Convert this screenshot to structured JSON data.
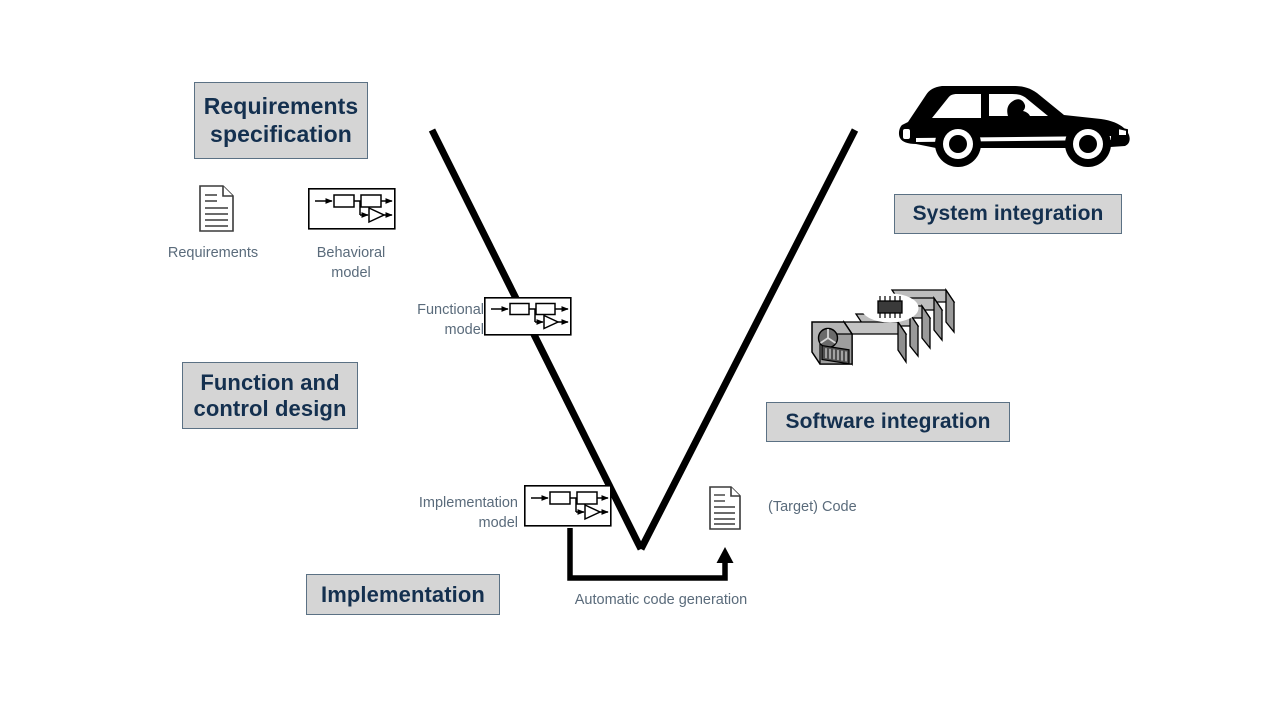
{
  "diagram": {
    "title": "V-model development process",
    "type": "v-model",
    "background_color": "#ffffff"
  },
  "colors": {
    "box_fill": "#d5d5d5",
    "box_border": "#5b7184",
    "box_text": "#14304f",
    "caption_text": "#5a6b7b",
    "line": "#000000",
    "ecu_body": "#a8a8a8"
  },
  "stages": {
    "left": [
      {
        "id": "requirements-specification",
        "label": "Requirements\nspecification"
      },
      {
        "id": "function-and-control-design",
        "label": "Function and\ncontrol design"
      },
      {
        "id": "implementation",
        "label": "Implementation"
      }
    ],
    "right": [
      {
        "id": "system-integration",
        "label": "System integration"
      },
      {
        "id": "software-integration",
        "label": "Software integration"
      }
    ]
  },
  "artifacts": [
    {
      "id": "requirements",
      "label": "Requirements",
      "icon": "document-icon"
    },
    {
      "id": "behavioral-model",
      "label": "Behavioral\nmodel",
      "icon": "block-diagram-icon"
    },
    {
      "id": "functional-model",
      "label": "Functional\nmodel",
      "icon": "block-diagram-icon"
    },
    {
      "id": "implementation-model",
      "label": "Implementation\nmodel",
      "icon": "block-diagram-icon"
    },
    {
      "id": "target-code",
      "label": "(Target) Code",
      "icon": "document-icon"
    },
    {
      "id": "vehicle",
      "label": "",
      "icon": "car-icon"
    },
    {
      "id": "ecu",
      "label": "",
      "icon": "ecu-icon"
    }
  ],
  "flow": {
    "code_generation_label": "Automatic code generation",
    "code_generation_from": "implementation-model",
    "code_generation_to": "target-code"
  },
  "v_shape": {
    "left_top": [
      432,
      130
    ],
    "vertex": [
      641,
      549
    ],
    "right_top": [
      855,
      130
    ],
    "stroke_width": 7
  }
}
